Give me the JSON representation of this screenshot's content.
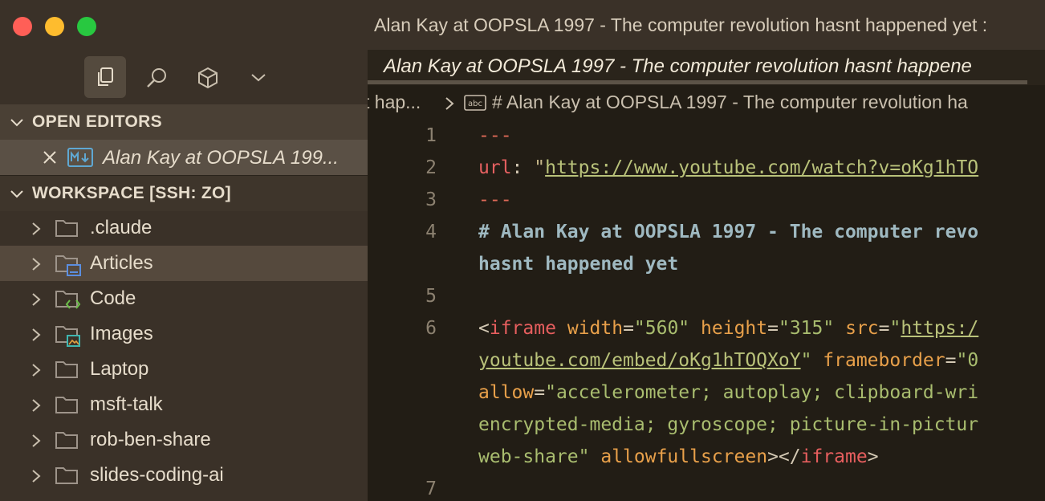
{
  "window": {
    "title": "Alan Kay at OOPSLA 1997 - The computer revolution hasnt happened yet :"
  },
  "activity_bar": {
    "icons": [
      "explorer-icon",
      "search-icon",
      "extensions-icon",
      "chevron-down-icon"
    ]
  },
  "sidebar": {
    "open_editors_label": "OPEN EDITORS",
    "open_editor_item": "Alan Kay at OOPSLA 199...",
    "workspace_label": "WORKSPACE [SSH: ZO]",
    "folders": [
      {
        "name": ".claude",
        "icon": "folder-icon"
      },
      {
        "name": "Articles",
        "icon": "folder-articles-icon"
      },
      {
        "name": "Code",
        "icon": "folder-code-icon"
      },
      {
        "name": "Images",
        "icon": "folder-images-icon"
      },
      {
        "name": "Laptop",
        "icon": "folder-icon"
      },
      {
        "name": "msft-talk",
        "icon": "folder-icon"
      },
      {
        "name": "rob-ben-share",
        "icon": "folder-icon"
      },
      {
        "name": "slides-coding-ai",
        "icon": "folder-icon"
      }
    ],
    "selected_folder": "Articles"
  },
  "editor": {
    "tab_title": "Alan Kay at OOPSLA 1997 - The computer revolution hasnt happene",
    "breadcrumb_prev": "t hap...",
    "breadcrumb_current": "# Alan Kay at OOPSLA 1997 - The computer revolution ha",
    "line_numbers": [
      "1",
      "2",
      "3",
      "4",
      "5",
      "6",
      "7"
    ],
    "lines": {
      "l1": "---",
      "l2_key": "url",
      "l2_colon": ": ",
      "l2_quote": "\"",
      "l2_url": "https://www.youtube.com/watch?v=oKg1hTO",
      "l3": "---",
      "l4a": "# Alan Kay at OOPSLA 1997 - The computer revo",
      "l4b": "hasnt happened yet",
      "l6a_tag": "iframe",
      "l6a_attr1": "width",
      "l6a_val1": "\"560\"",
      "l6a_attr2": "height",
      "l6a_val2": "\"315\"",
      "l6a_attr3": "src",
      "l6a_val3q": "\"",
      "l6a_val3": "https:/",
      "l6b_link": "youtube.com/embed/oKg1hTOQXoY",
      "l6b_q": "\"",
      "l6b_attr": "frameborder",
      "l6b_val": "\"0",
      "l6c_attr": "allow",
      "l6c_val": "\"accelerometer; autoplay; clipboard-wri",
      "l6d_val": "encrypted-media; gyroscope; picture-in-pictur",
      "l6e_val": "web-share\"",
      "l6e_attr": "allowfullscreen",
      "l6e_close": "iframe"
    }
  },
  "colors": {
    "titlebar": "#3a3128",
    "editor_bg": "#221d15",
    "accent_red": "#ff5f57",
    "accent_yellow": "#febc2e",
    "accent_green": "#28c840"
  }
}
